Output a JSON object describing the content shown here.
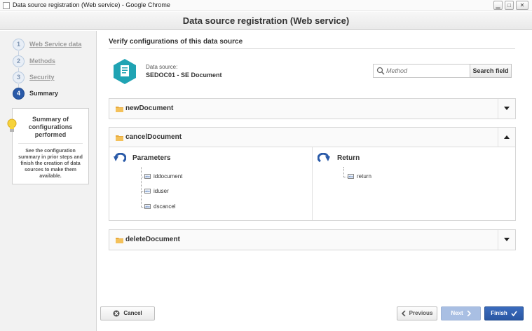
{
  "window": {
    "title": "Data source registration (Web service) - Google Chrome"
  },
  "dialog": {
    "title": "Data source registration (Web service)"
  },
  "steps": [
    {
      "num": "1",
      "label": "Web Service data"
    },
    {
      "num": "2",
      "label": "Methods"
    },
    {
      "num": "3",
      "label": "Security"
    },
    {
      "num": "4",
      "label": "Summary"
    }
  ],
  "summary_box": {
    "title": "Summary of configurations performed",
    "description": "See the configuration summary in prior steps and finish the creation of data sources to make them available."
  },
  "main": {
    "section_title": "Verify configurations of this data source",
    "data_source_label": "Data source:",
    "data_source_name": "SEDOC01 - SE Document",
    "search_placeholder": "Method",
    "search_button": "Search field"
  },
  "methods": [
    {
      "name": "newDocument",
      "expanded": false
    },
    {
      "name": "cancelDocument",
      "expanded": true,
      "parameters_label": "Parameters",
      "parameters": [
        "iddocument",
        "iduser",
        "dscancel"
      ],
      "return_label": "Return",
      "returns": [
        "return"
      ]
    },
    {
      "name": "deleteDocument",
      "expanded": false
    }
  ],
  "footer": {
    "cancel": "Cancel",
    "previous": "Previous",
    "next": "Next",
    "finish": "Finish"
  },
  "colors": {
    "accent": "#2a5aa8",
    "teal": "#1fa3b3",
    "folder": "#e8a93a"
  }
}
